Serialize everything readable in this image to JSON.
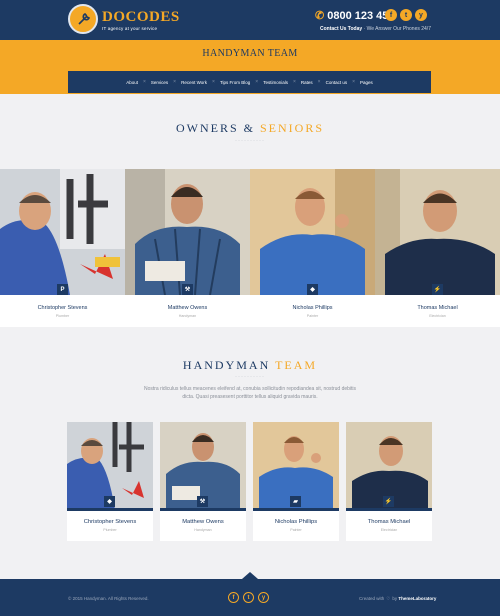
{
  "header": {
    "brand": "DOCODES",
    "tagline": "IT agency at your service",
    "phone": "0800 123 456",
    "contact_link": "Contact Us Today",
    "contact_note": " · We Answer Our Phones 24/7",
    "social": [
      "f",
      "t",
      "y"
    ]
  },
  "banner": {
    "title": "HANDYMAN TEAM",
    "nav": [
      "About",
      "Services",
      "Recent Work",
      "Tips From Blog",
      "Testimonials",
      "Rates",
      "Contact us",
      "Pages"
    ]
  },
  "owners": {
    "title_dark": "OWNERS &",
    "title_accent": "SENIORS",
    "people": [
      {
        "name": "Christopher Stevens",
        "role": "Plumber",
        "icon": "P"
      },
      {
        "name": "Matthew Owens",
        "role": "Handyman",
        "icon": "⚒"
      },
      {
        "name": "Nicholas Phillips",
        "role": "Painter",
        "icon": "◆"
      },
      {
        "name": "Thomas Michael",
        "role": "Electrician",
        "icon": "⚡"
      }
    ]
  },
  "team": {
    "title_dark": "HANDYMAN",
    "title_accent": "TEAM",
    "description": "Nostra ridiculus tellus meacenes eleifend at, conubia sollicitudin repodiandea sit, nostrud debitis dicta. Quasi preasesent porttitor tellus aliquid gravida mauris.",
    "members": [
      {
        "name": "Christopher Stevens",
        "role": "Plumber",
        "icon": "◆"
      },
      {
        "name": "Matthew Owens",
        "role": "Handyman",
        "icon": "⚒"
      },
      {
        "name": "Nicholas Phillips",
        "role": "Painter",
        "icon": "▰"
      },
      {
        "name": "Thomas Michael",
        "role": "Electrician",
        "icon": "⚡"
      }
    ]
  },
  "footer": {
    "copyright": "© 2015 Handyman. All Rights Reserved.",
    "credit_prefix": "Created with",
    "credit_by": "by",
    "credit_brand": "ThemeLaboratory",
    "social": [
      "f",
      "t",
      "y"
    ]
  },
  "colors": {
    "navy": "#1d3a63",
    "accent": "#f4a826",
    "page_bg": "#f1f1f3"
  }
}
